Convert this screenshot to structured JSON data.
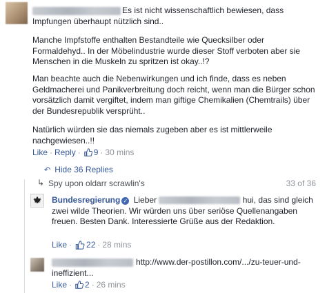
{
  "comment": {
    "text_line1": "Es ist nicht wissenschaftlich bewiesen, dass Impfungen überhaupt nützlich sind..",
    "paragraph2": "Manche Impfstoffe enthalten Bestandteile wie Quecksilber oder Formaldehyd.. In der Möbelindustrie wurde dieser Stoff verboten aber sie Menschen in die Muskeln zu spritzen ist okay..!?",
    "paragraph3": "Man beachte auch die Nebenwirkungen und ich finde, dass es neben Geldmacherei und Panikverbreitung doch reicht, wenn man die Bürger schon vorsätzlich damit vergiftet, indem man giftige Chemikalien (Chemtrails) über der Bundesrepublik versprüht..",
    "paragraph4": "Natürlich würden sie das niemals zugeben aber es ist mittlerweile nachgewiesen..!!",
    "like_label": "Like",
    "reply_label": "Reply",
    "likes": "9",
    "time": "30 mins"
  },
  "thread": {
    "hide_label": "Hide 36 Replies",
    "spy_label": "Spy upon oldarr scrawlin's",
    "count_label": "33 of 36"
  },
  "replies": [
    {
      "name": "Bundesregierung",
      "text_before": "Lieber",
      "text_after": "hui, das sind gleich zwei wilde Theorien. Wir würden uns über seriöse Quellenangaben freuen. Besten Dank. Interessierte Grüße aus der Redaktion.",
      "like_label": "Like",
      "likes": "22",
      "time": "28 mins"
    },
    {
      "url": "http://www.der-postillon.com/.../zu-teuer-und-ineffizient...",
      "like_label": "Like",
      "likes": "2",
      "time": "26 mins"
    }
  ],
  "colors": {
    "link": "#365899",
    "text": "#1d2129",
    "meta": "#90949c"
  }
}
